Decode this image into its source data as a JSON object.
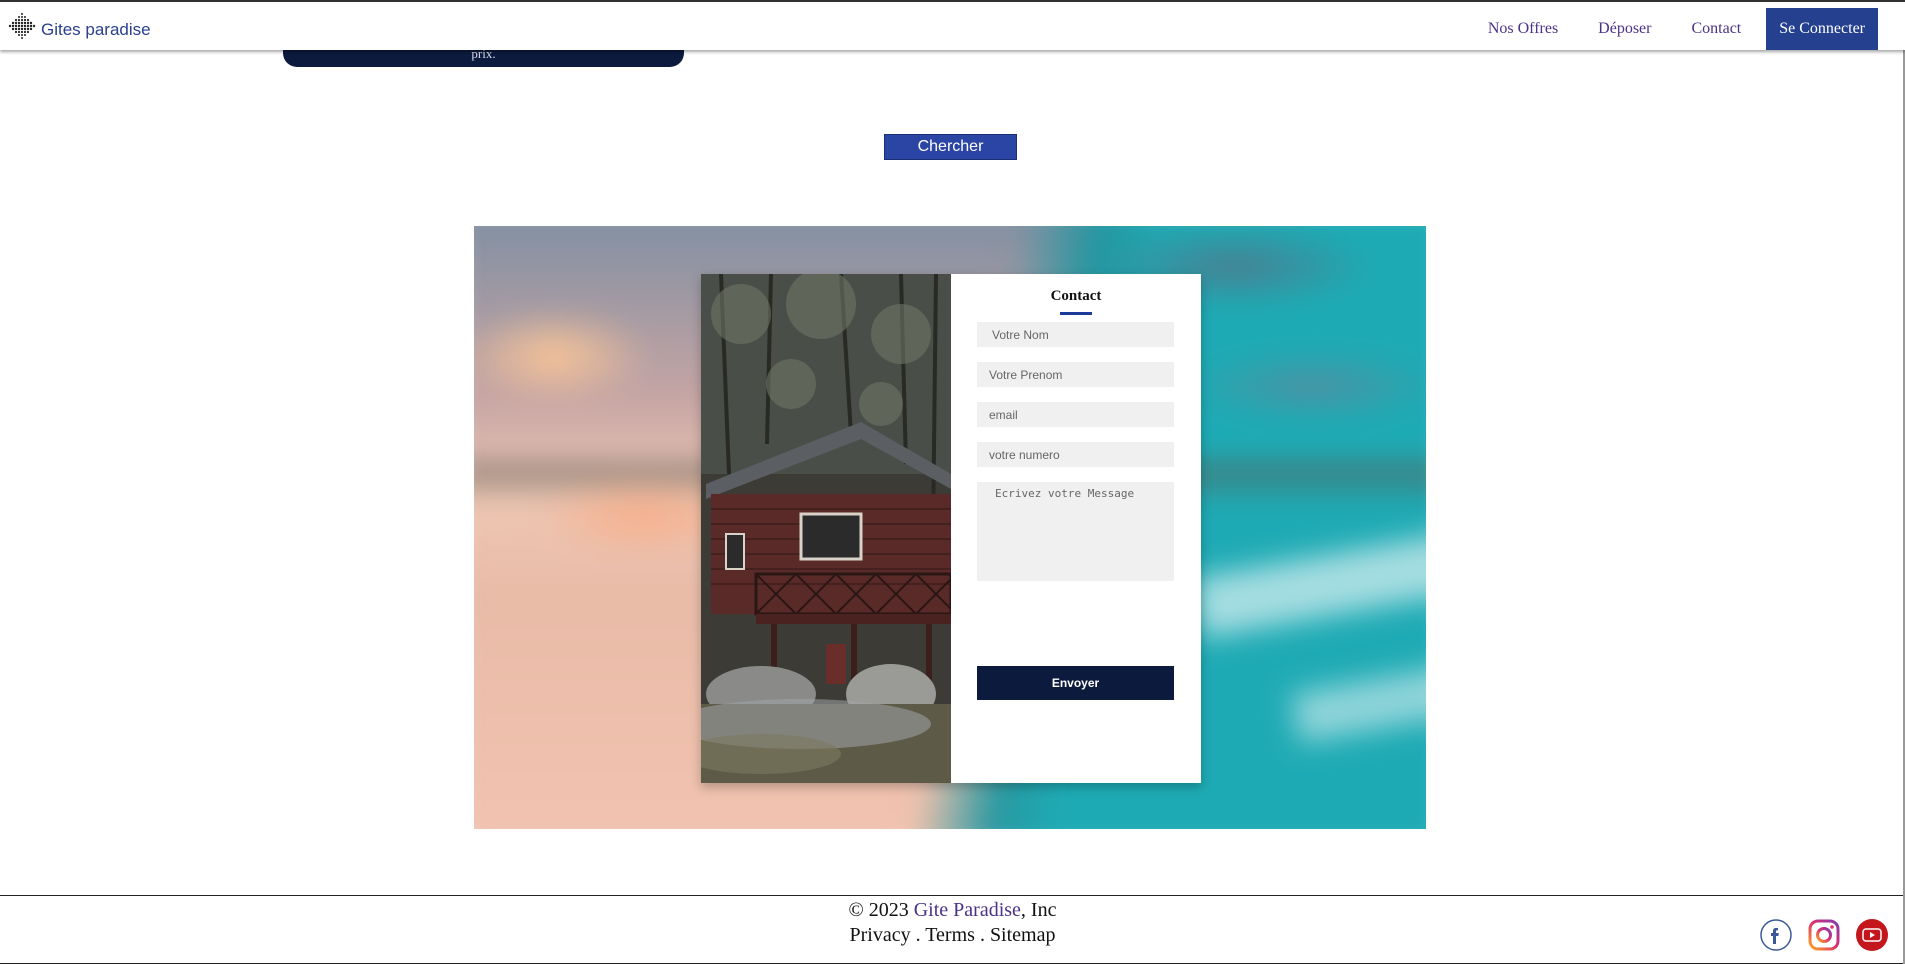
{
  "header": {
    "brand": "Gites paradise",
    "nav": [
      {
        "label": "Nos Offres"
      },
      {
        "label": "Déposer"
      },
      {
        "label": "Contact"
      },
      {
        "label": "Se Connecter"
      }
    ]
  },
  "search": {
    "pill_text": "prix.",
    "button_label": "Chercher"
  },
  "contact": {
    "title": "Contact",
    "fields": {
      "nom_placeholder": "Votre Nom",
      "prenom_placeholder": "Votre Prenom",
      "email_placeholder": "email",
      "numero_placeholder": "votre numero",
      "message_placeholder": "Ecrivez votre Message"
    },
    "submit_label": "Envoyer"
  },
  "footer": {
    "copyright_prefix": "© 2023 ",
    "company_link": "Gite Paradise",
    "copyright_suffix": ", Inc",
    "links": [
      "Privacy",
      "Terms",
      "Sitemap"
    ],
    "separator": " . ",
    "socials": [
      "facebook-icon",
      "instagram-icon",
      "youtube-icon"
    ]
  },
  "colors": {
    "navy": "#0c1a3e",
    "accent_blue": "#24408e",
    "link_purple": "#4b3287"
  }
}
